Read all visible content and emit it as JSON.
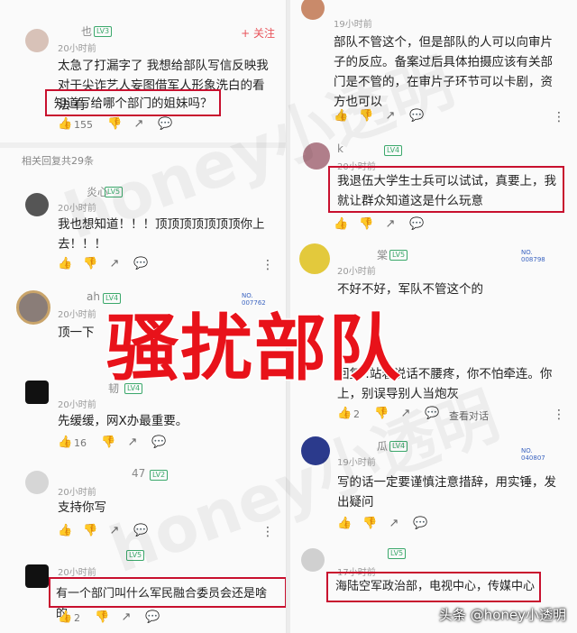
{
  "overlay": {
    "big_title": "骚扰部队",
    "footer_mark": "头条 @honey小透明",
    "watermark": "honey小透明"
  },
  "left": {
    "c1": {
      "name": "也",
      "badge": "LV3",
      "time": "20小时前",
      "follow": "+ 关注",
      "text_a": "太急了打漏字了 我想给部队写信反映我对于尖诈艺人妄图借军人形象洗白的看法 有",
      "text_b": "知道写给哪个部门的姐妹吗？",
      "likes": "155"
    },
    "related": "相关回复共29条",
    "c2": {
      "name": "炎心",
      "badge": "LV5",
      "time": "20小时前",
      "text": "我也想知道！！！顶顶顶顶顶顶顶你上去！！！"
    },
    "c3": {
      "name": "ah",
      "badge": "LV4",
      "time": "20小时前",
      "nft_no": "NO.",
      "nft_id": "007762",
      "text": "顶一下"
    },
    "c4": {
      "name": "韧",
      "badge": "LV4",
      "time": "20小时前",
      "text": "先缓缓，网X办最重要。",
      "likes": "16"
    },
    "c5": {
      "name": "47",
      "badge": "LV2",
      "time": "20小时前",
      "text": "支持你写"
    },
    "c6": {
      "name": "",
      "badge": "LV5",
      "time": "20小时前",
      "text": "有一个部门叫什么军民融合委员会还是啥的",
      "likes": "2"
    }
  },
  "right": {
    "r1": {
      "time": "19小时前",
      "text": "部队不管这个，但是部队的人可以向审片子的反应。备案过后具体拍摄应该有关部门是不管的，在审片子环节可以卡剧，资方也可以"
    },
    "r2": {
      "name": "k",
      "badge": "LV4",
      "time": "20小时前",
      "text": "我退伍大学生士兵可以试试，真要上，我就让群众知道这是什么玩意"
    },
    "r3": {
      "name": "棠",
      "badge": "LV5",
      "time": "20小时前",
      "nft_no": "NO.",
      "nft_id": "008798",
      "text": "不好不好，军队不管这个的"
    },
    "r4": {
      "text": "回复 :站着说话不腰疼，你不怕牵连。你上，别误导别人当炮灰",
      "likes": "2",
      "view": "查看对话"
    },
    "r5": {
      "name": "瓜",
      "badge": "LV4",
      "time": "19小时前",
      "nft_no": "NO.",
      "nft_id": "040807",
      "text": "写的话一定要谨慎注意措辞，用实锤，发出疑问"
    },
    "r6": {
      "badge": "LV5",
      "time": "17小时前",
      "text": "海陆空军政治部，电视中心，传媒中心"
    }
  }
}
